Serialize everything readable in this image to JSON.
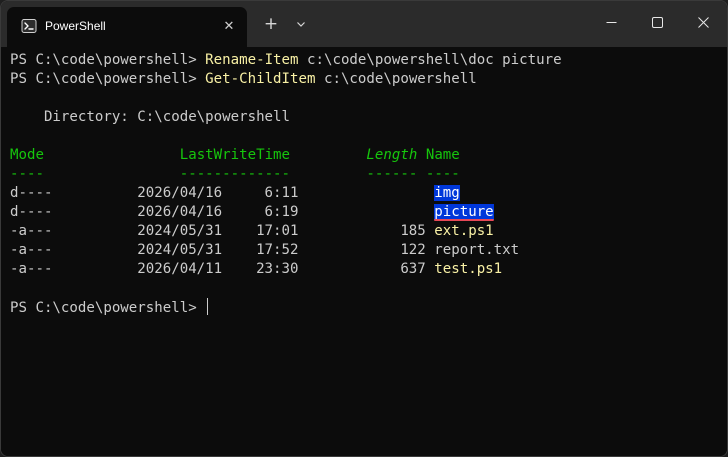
{
  "window": {
    "tab_title": "PowerShell",
    "tab_icon": "powershell-icon",
    "new_tab": "+",
    "dropdown": "⌵"
  },
  "terminal": {
    "line1": {
      "prompt": "PS C:\\code\\powershell> ",
      "command": "Rename-Item",
      "args": " c:\\code\\powershell\\doc picture"
    },
    "line2": {
      "prompt": "PS C:\\code\\powershell> ",
      "command": "Get-ChildItem",
      "args": " c:\\code\\powershell"
    },
    "directory": "    Directory: C:\\code\\powershell",
    "headers": {
      "mode": "Mode",
      "gap1": "                ",
      "last_write": "LastWriteTime",
      "gap2": "         ",
      "length": "Length",
      "gap3": " ",
      "name": "Name"
    },
    "underline": {
      "mode": "----",
      "gap1": "                ",
      "last_write": "-------------",
      "gap2": "         ",
      "length": "------",
      "gap3": " ",
      "name": "----"
    },
    "rows": [
      {
        "text": "d----          2026/04/16     6:11                ",
        "name": "img"
      },
      {
        "text": "d----          2026/04/16     6:19                ",
        "name": "picture"
      },
      {
        "text": "-a---          2024/05/31    17:01            185 ",
        "name": "ext.ps1"
      },
      {
        "text": "-a---          2024/05/31    17:52            122 ",
        "name": "report.txt"
      },
      {
        "text": "-a---          2026/04/11    23:30            637 ",
        "name": "test.ps1"
      }
    ],
    "final_prompt": "PS C:\\code\\powershell> "
  },
  "colors": {
    "background": "#0c0c0c",
    "titlebar": "#2b2b2b",
    "command_yellow": "#f9f1a5",
    "header_green": "#16c60c",
    "selection_blue": "#0037da",
    "selection_underline": "#e74856"
  }
}
